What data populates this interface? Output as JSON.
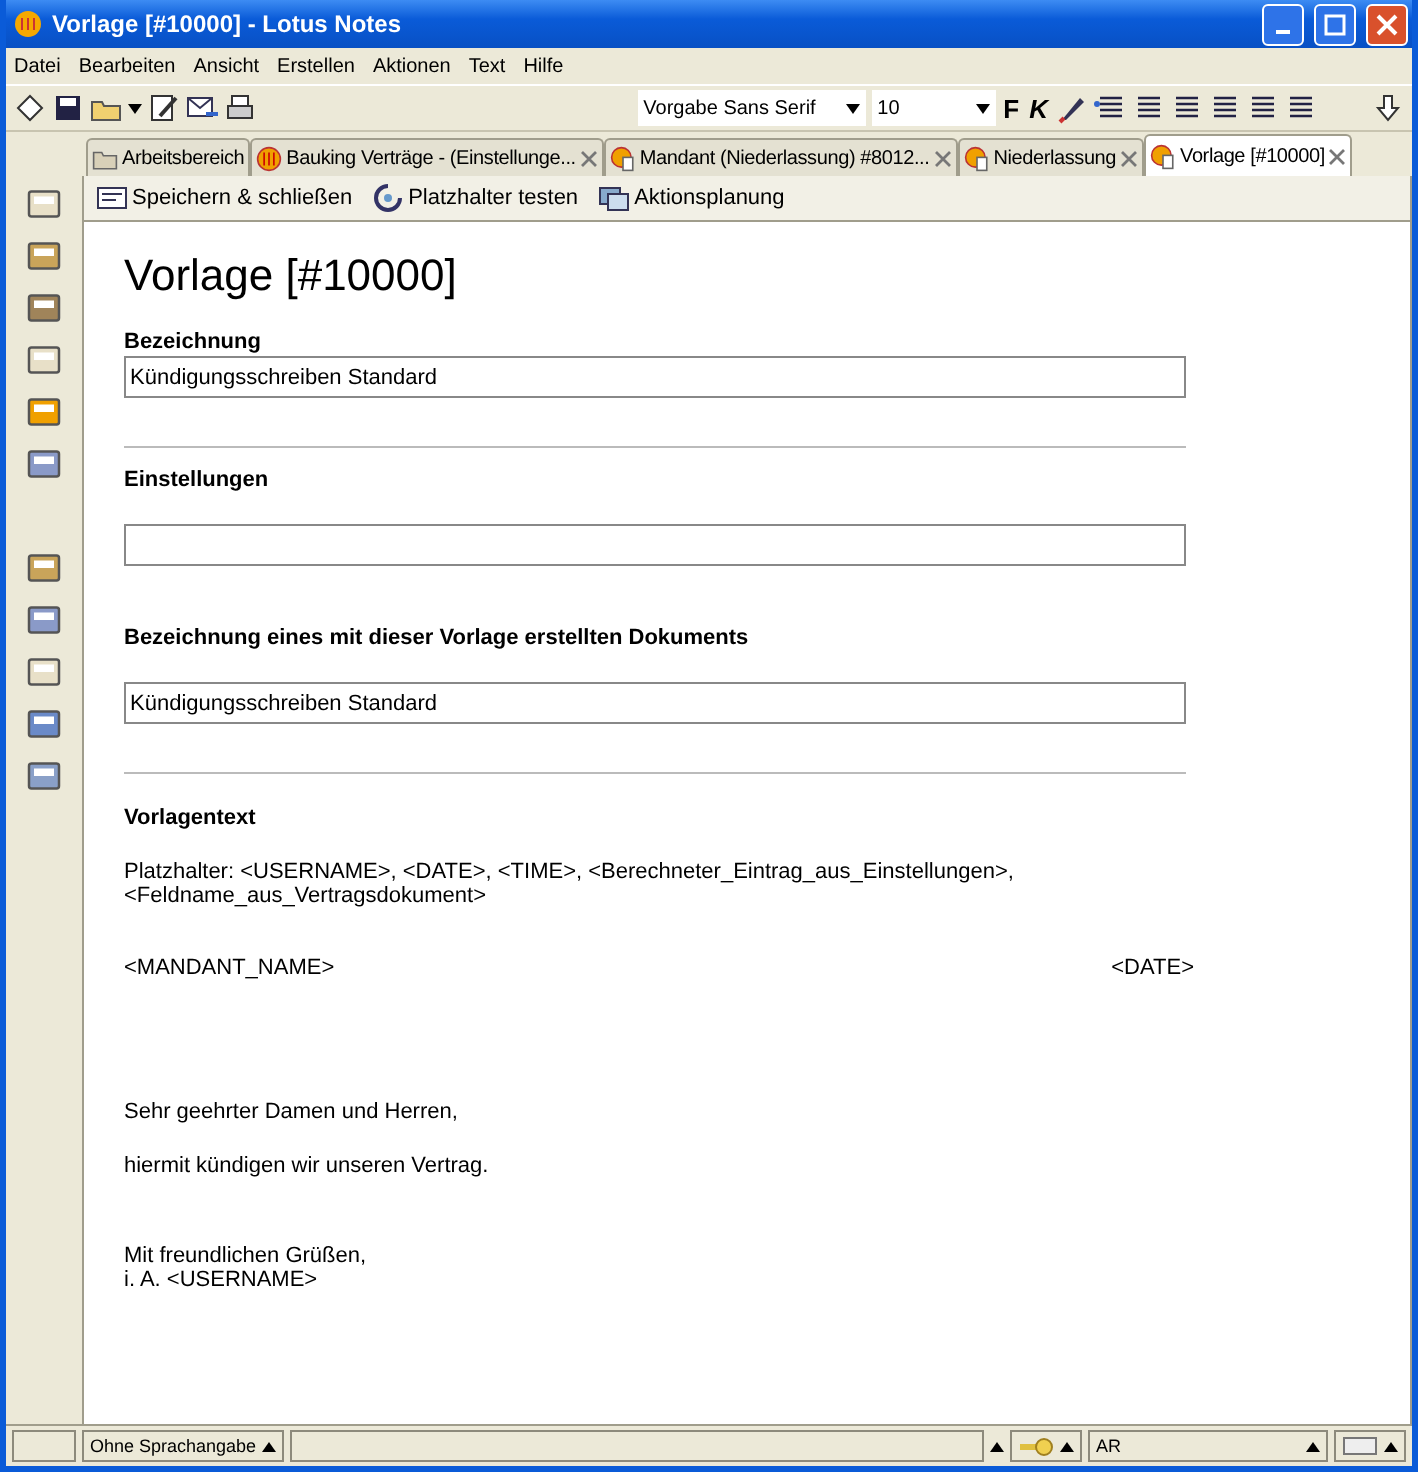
{
  "window": {
    "title": "Vorlage [#10000] - Lotus Notes"
  },
  "menu": [
    {
      "label": "Datei"
    },
    {
      "label": "Bearbeiten"
    },
    {
      "label": "Ansicht"
    },
    {
      "label": "Erstellen"
    },
    {
      "label": "Aktionen"
    },
    {
      "label": "Text"
    },
    {
      "label": "Hilfe"
    }
  ],
  "toolbar": {
    "font": "Vorgabe Sans Serif",
    "size": "10",
    "bold": "F",
    "italic": "K"
  },
  "tabs": [
    {
      "label": "Arbeitsbereich",
      "kind": "home",
      "closable": false,
      "selected": false
    },
    {
      "label": "Bauking Verträge - (Einstellunge...",
      "kind": "db",
      "closable": true,
      "selected": false
    },
    {
      "label": "Mandant (Niederlassung) #8012...",
      "kind": "doc",
      "closable": true,
      "selected": false
    },
    {
      "label": "Niederlassung",
      "kind": "doc",
      "closable": true,
      "selected": false
    },
    {
      "label": "Vorlage [#10000]",
      "kind": "doc",
      "closable": true,
      "selected": true
    }
  ],
  "actions": [
    {
      "label": "Speichern & schließen",
      "kind": "save"
    },
    {
      "label": "Platzhalter testen",
      "kind": "test"
    },
    {
      "label": "Aktionsplanung",
      "kind": "plan"
    }
  ],
  "document": {
    "heading": "Vorlage [#10000]",
    "fields": [
      {
        "label": "Bezeichnung",
        "value": "Kündigungsschreiben Standard"
      },
      {
        "label": "Einstellungen"
      },
      {
        "label": "Bezeichnung eines mit dieser Vorlage erstellten Dokuments",
        "value": "Kündigungsschreiben Standard"
      }
    ],
    "template_label": "Vorlagentext",
    "placeholders": "Platzhalter: <USERNAME>, <DATE>, <TIME>, <Berechneter_Eintrag_aus_Einstellungen>, <Feldname_aus_Vertragsdokument>",
    "recipient": "<MANDANT_NAME>",
    "date": "<DATE>",
    "salutation": "Sehr geehrter Damen und Herren,",
    "body": "hiermit kündigen wir unseren Vertrag.",
    "closing": [
      "Mit freundlichen Grüßen,",
      "i. A. <USERNAME>"
    ]
  },
  "status_bar": {
    "language": "Ohne Sprachangabe",
    "location": "AR"
  }
}
